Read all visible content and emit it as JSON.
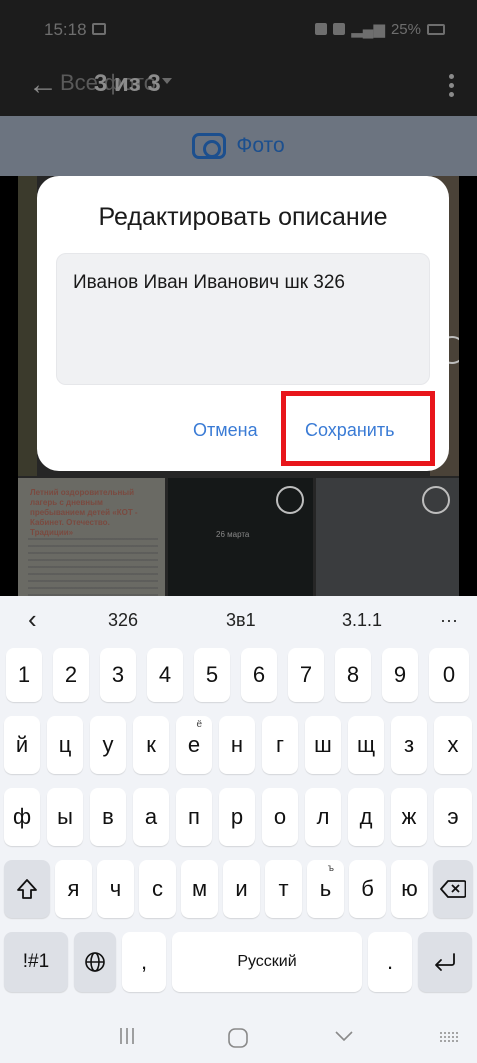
{
  "status_bar": {
    "time": "15:18",
    "battery": "25%"
  },
  "app_bar": {
    "breadcrumb": "Все фото",
    "counter": "3 из 3"
  },
  "photo_bar": {
    "label": "Фото"
  },
  "grid": {
    "poster_title": "Летний оздоровительный лагерь с дневным пребыванием детей «КОТ - Кабинет. Отечество. Традиции»",
    "date_chip": "26 марта"
  },
  "dialog": {
    "title": "Редактировать описание",
    "description_value": "Иванов Иван Иванович шк 326",
    "cancel_label": "Отмена",
    "save_label": "Сохранить"
  },
  "keyboard": {
    "suggestions": [
      "326",
      "3в1",
      "3.1.1"
    ],
    "more": "···",
    "back": "‹",
    "row_digits": [
      "1",
      "2",
      "3",
      "4",
      "5",
      "6",
      "7",
      "8",
      "9",
      "0"
    ],
    "row1": [
      "й",
      "ц",
      "у",
      "к",
      "е",
      "н",
      "г",
      "ш",
      "щ",
      "з",
      "х"
    ],
    "row1_alt_e": "ё",
    "row2": [
      "ф",
      "ы",
      "в",
      "а",
      "п",
      "р",
      "о",
      "л",
      "д",
      "ж",
      "э"
    ],
    "row3": [
      "я",
      "ч",
      "с",
      "м",
      "и",
      "т",
      "ь",
      "б",
      "ю"
    ],
    "row3_alt_soft": "ъ",
    "symbols_label": "!#1",
    "comma": ",",
    "space_label": "Русский",
    "period": "."
  },
  "colors": {
    "accent": "#3a7bd5",
    "highlight": "#e8151b",
    "keyboard_bg": "#f1f3f7"
  }
}
